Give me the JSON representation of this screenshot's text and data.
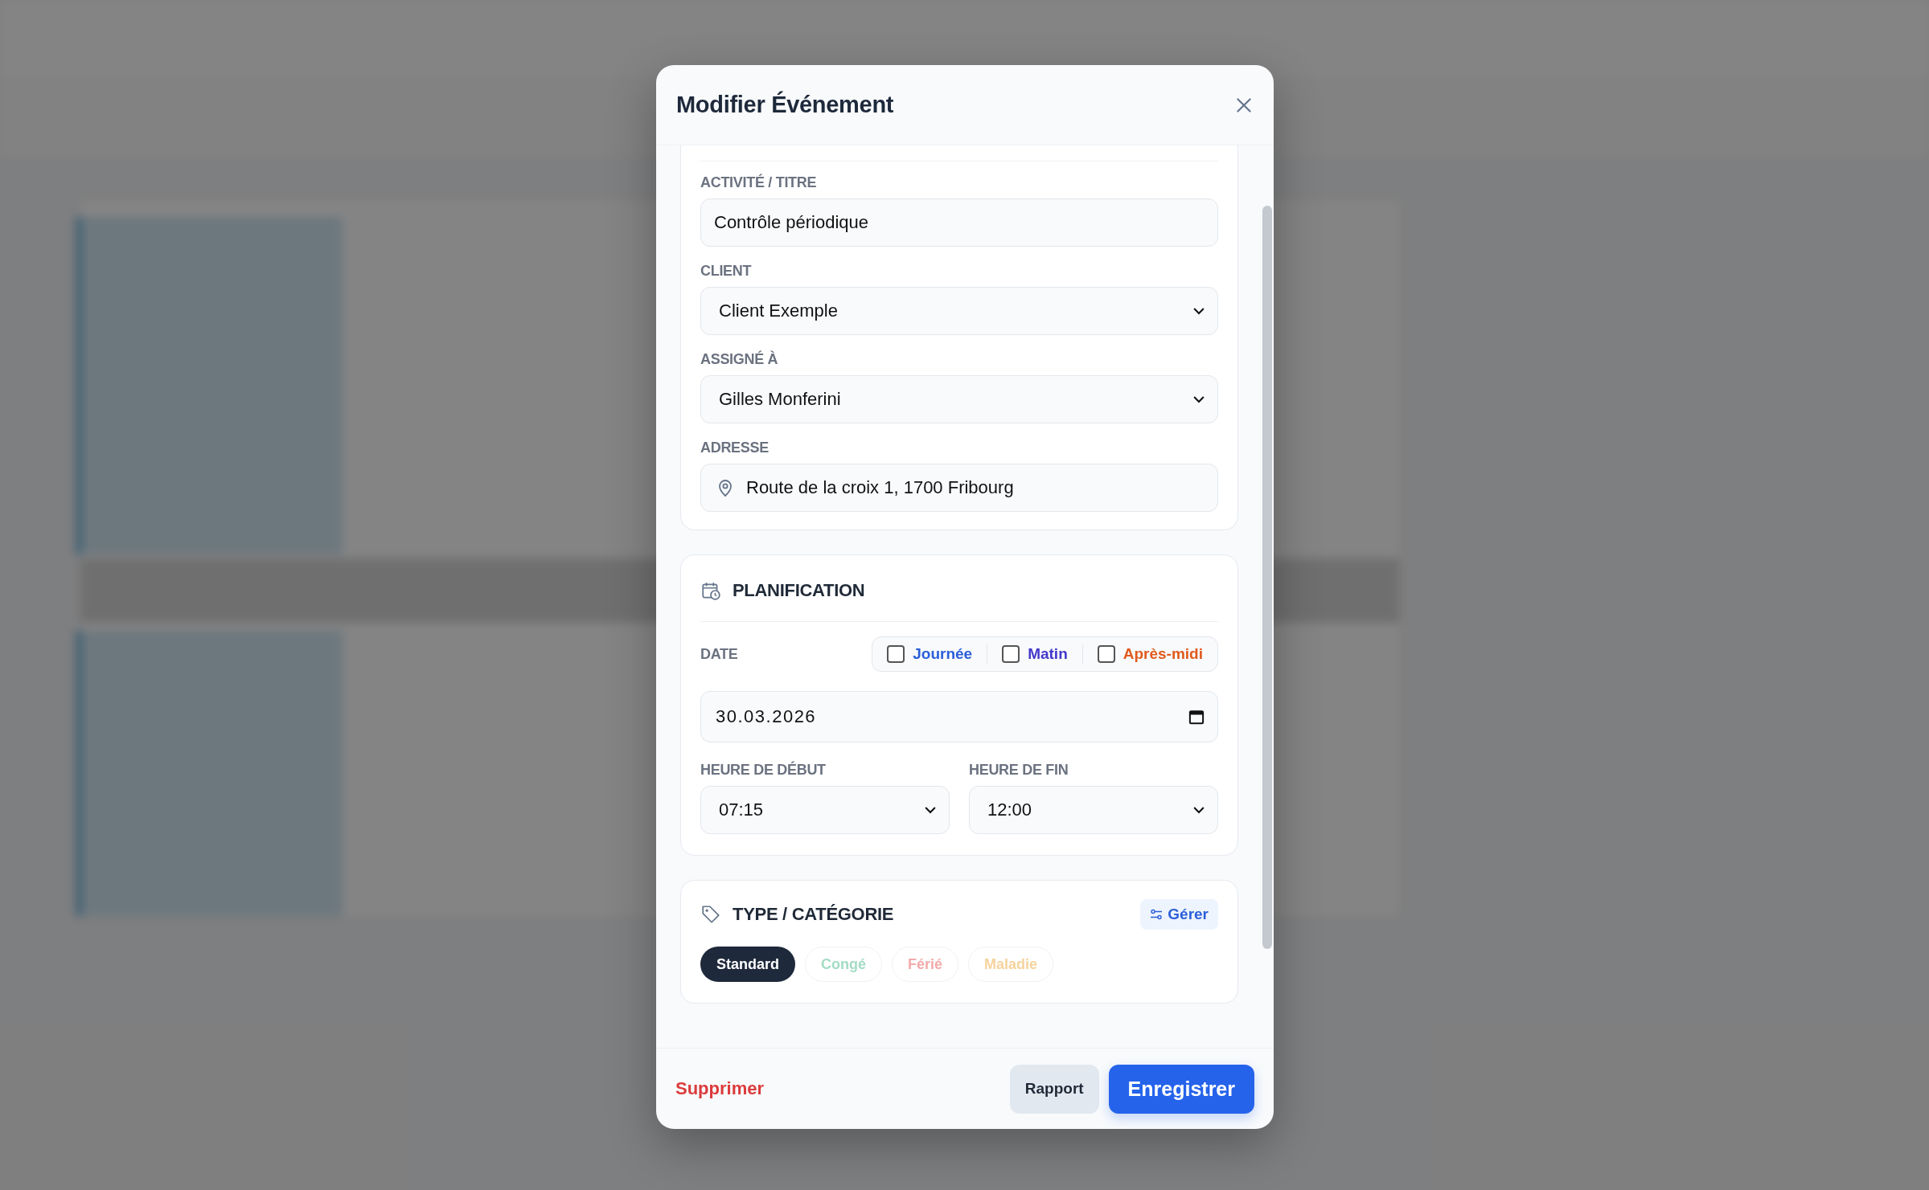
{
  "dialog": {
    "title": "Modifier Événement"
  },
  "fields": [
    {
      "kind": "text",
      "label": "ACTIVITÉ / TITRE",
      "value": "Contrôle périodique"
    },
    {
      "kind": "select",
      "label": "CLIENT",
      "value": "Client Exemple"
    },
    {
      "kind": "select",
      "label": "ASSIGNÉ À",
      "value": "Gilles Monferini"
    },
    {
      "kind": "address",
      "label": "ADRESSE",
      "value": "Route de la croix 1, 1700 Fribourg"
    }
  ],
  "planification": {
    "title": "PLANIFICATION",
    "date_label": "DATE",
    "options": [
      {
        "label": "Journée",
        "checked": false,
        "color": "#2b5fd9"
      },
      {
        "label": "Matin",
        "checked": false,
        "color": "#4338ca"
      },
      {
        "label": "Après-midi",
        "checked": false,
        "color": "#e05a1c"
      }
    ],
    "date": "30.03.2026",
    "start": {
      "label": "HEURE DE DÉBUT",
      "value": "07:15"
    },
    "end": {
      "label": "HEURE DE FIN",
      "value": "12:00"
    }
  },
  "category": {
    "title": "TYPE / CATÉGORIE",
    "manage": "Gérer",
    "chips": [
      {
        "label": "Standard",
        "selected": true,
        "color": "#1e293b"
      },
      {
        "label": "Congé",
        "selected": false,
        "color": "#a3dcc4"
      },
      {
        "label": "Férié",
        "selected": false,
        "color": "#f3a9a9"
      },
      {
        "label": "Maladie",
        "selected": false,
        "color": "#f6d39c"
      }
    ]
  },
  "footer": {
    "delete": "Supprimer",
    "report": "Rapport",
    "save": "Enregistrer"
  }
}
